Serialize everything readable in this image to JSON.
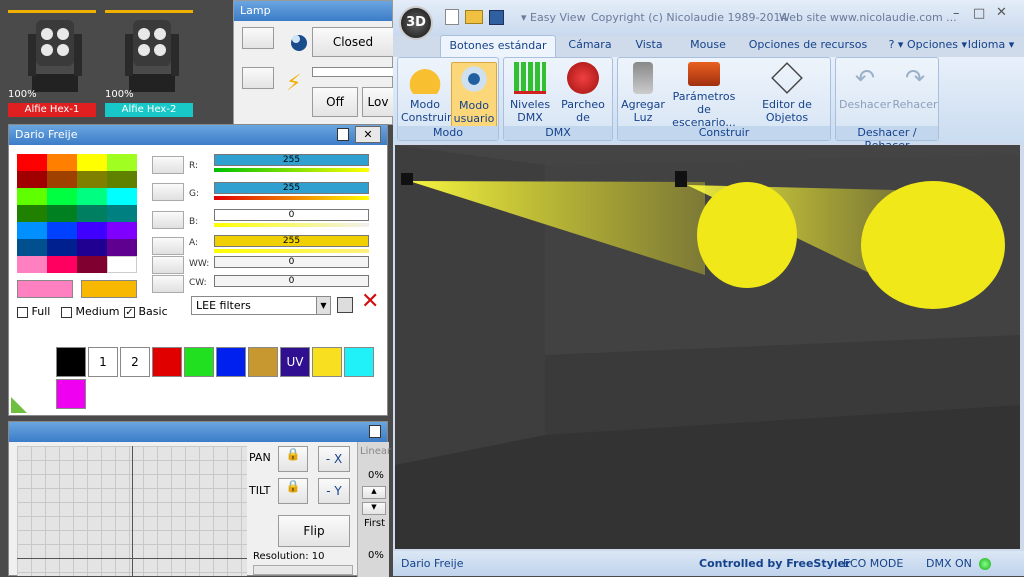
{
  "fixtures": [
    {
      "pct": "100%",
      "name": "Alfie Hex-1",
      "color": "#e02020"
    },
    {
      "pct": "100%",
      "name": "Alfie Hex-2",
      "color": "#18c8c8"
    }
  ],
  "lamp": {
    "title": "Lamp",
    "closed_label": "Closed",
    "off_label": "Off",
    "low_label": "Lov"
  },
  "color_panel": {
    "title": "Dario Freije",
    "close_label": "✕",
    "sliders": [
      {
        "label": "R:",
        "value": "255",
        "color": "#30a0d0",
        "strip": "linear-gradient(90deg,#00c000,#ffff00)"
      },
      {
        "label": "G:",
        "value": "255",
        "color": "#30a0d0",
        "strip": "linear-gradient(90deg,#e00000,#ffff00)"
      },
      {
        "label": "B:",
        "value": "0",
        "color": "#ffffff",
        "strip": "linear-gradient(90deg,#ffff00,#f0f0f0)"
      },
      {
        "label": "A:",
        "value": "255",
        "color": "#f0d000",
        "strip": "linear-gradient(90deg,#ffff00,#fff080)"
      },
      {
        "label": "WW:",
        "value": "0",
        "color": "#f4f4f4",
        "strip": ""
      },
      {
        "label": "CW:",
        "value": "0",
        "color": "#f4f4f4",
        "strip": ""
      }
    ],
    "filter": "LEE filters",
    "full_label": "Full",
    "medium_label": "Medium",
    "basic_label": "Basic",
    "palette": [
      {
        "color": "#000000",
        "text": ""
      },
      {
        "color": "#ffffff",
        "text": "1"
      },
      {
        "color": "#ffffff",
        "text": "2"
      },
      {
        "color": "#e00000",
        "text": ""
      },
      {
        "color": "#20e020",
        "text": ""
      },
      {
        "color": "#0020f0",
        "text": ""
      },
      {
        "color": "#c89830",
        "text": ""
      },
      {
        "color": "#301090",
        "text": "UV"
      },
      {
        "color": "#f8e020",
        "text": ""
      },
      {
        "color": "#20f0f8",
        "text": ""
      },
      {
        "color": "#f000f0",
        "text": ""
      }
    ]
  },
  "pan_panel": {
    "pan_label": "PAN",
    "tilt_label": "TILT",
    "x_label": "- X",
    "y_label": "- Y",
    "flip_label": "Flip",
    "resolution": "Resolution: 10",
    "linear_label": "Linear",
    "pct_top": "0%",
    "first_label": "First",
    "pct_bottom": "0%"
  },
  "app": {
    "title_left": "Easy View",
    "title_copy": "Copyright (c) Nicolaudie 1989-2014",
    "title_web": "Web site www.nicolaudie.com ...",
    "logo": "3D",
    "tabs": [
      "Botones estándar",
      "Cámara",
      "Vista",
      "Mouse",
      "Opciones de recursos"
    ],
    "tab_help": "? ▾",
    "tab_options": "Opciones ▾",
    "tab_lang": "Idioma ▾",
    "groups": [
      {
        "label": "Modo",
        "buttons": [
          "Modo\nConstruir",
          "Modo\nusuario"
        ]
      },
      {
        "label": "DMX",
        "buttons": [
          "Niveles\nDMX",
          "Parcheo de\nUniversos"
        ]
      },
      {
        "label": "Construir",
        "buttons": [
          "Agregar\nLuz",
          "Parámetros de\nescenario...",
          "Editor de\nObjetos simples"
        ]
      },
      {
        "label": "Deshacer / Rehacer",
        "buttons": [
          "Deshacer",
          "Rehacer"
        ]
      }
    ],
    "status_left": "Dario Freije",
    "status_ctrl": "Controlled by FreeStyler",
    "status_eco": "ECO MODE",
    "status_dmx": "DMX ON"
  }
}
